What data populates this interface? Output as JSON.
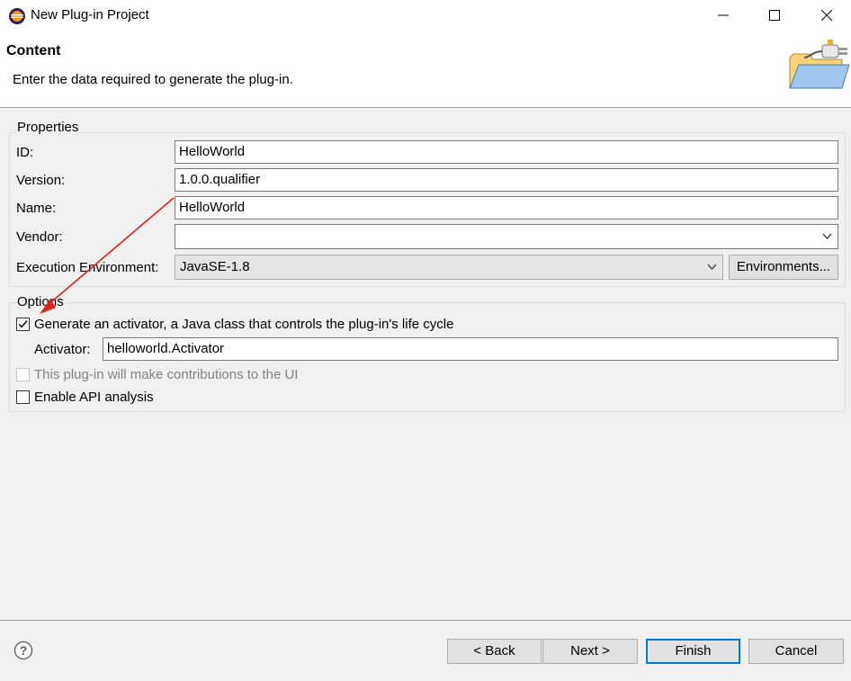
{
  "window": {
    "title": "New Plug-in Project"
  },
  "header": {
    "title": "Content",
    "description": "Enter the data required to generate the plug-in."
  },
  "properties": {
    "group_title": "Properties",
    "id_label": "ID:",
    "id_value": "HelloWorld",
    "version_label": "Version:",
    "version_value": "1.0.0.qualifier",
    "name_label": "Name:",
    "name_value": "HelloWorld",
    "vendor_label": "Vendor:",
    "vendor_value": "",
    "exec_env_label": "Execution Environment:",
    "exec_env_value": "JavaSE-1.8",
    "environments_button": "Environments..."
  },
  "options": {
    "group_title": "Options",
    "generate_activator_label": "Generate an activator, a Java class that controls the plug-in's life cycle",
    "generate_activator_checked": true,
    "activator_label": "Activator:",
    "activator_value": "helloworld.Activator",
    "ui_contrib_label": "This plug-in will make contributions to the UI",
    "ui_contrib_checked": false,
    "api_analysis_label": "Enable API analysis",
    "api_analysis_checked": false
  },
  "footer": {
    "back_label": "< Back",
    "next_label": "Next >",
    "finish_label": "Finish",
    "cancel_label": "Cancel"
  },
  "icons": {
    "app": "eclipse-icon",
    "minimize": "minimize-icon",
    "maximize": "maximize-icon",
    "close": "close-icon",
    "wizard": "plugin-folder-icon",
    "help": "help-icon",
    "annotation": "red-arrow"
  },
  "colors": {
    "accent": "#0078d7",
    "annotation": "#e02020"
  }
}
